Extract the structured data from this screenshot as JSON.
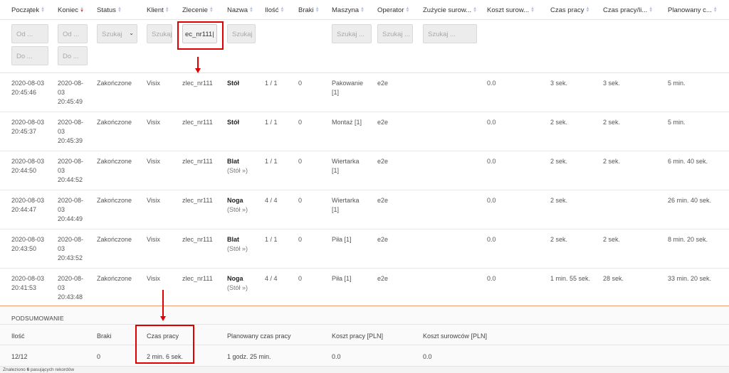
{
  "columns": [
    {
      "label": "Początek",
      "sort": "none"
    },
    {
      "label": "Koniec",
      "sort": "desc"
    },
    {
      "label": "Status",
      "sort": "none"
    },
    {
      "label": "Klient",
      "sort": "none"
    },
    {
      "label": "Zlecenie",
      "sort": "none"
    },
    {
      "label": "Nazwa",
      "sort": "none"
    },
    {
      "label": "Ilość",
      "sort": "none"
    },
    {
      "label": "Braki",
      "sort": "none"
    },
    {
      "label": "Maszyna",
      "sort": "none"
    },
    {
      "label": "Operator",
      "sort": "none"
    },
    {
      "label": "Zużycie surow...",
      "sort": "none"
    },
    {
      "label": "Koszt surow...",
      "sort": "none"
    },
    {
      "label": "Czas pracy",
      "sort": "none"
    },
    {
      "label": "Czas pracy/li...",
      "sort": "none"
    },
    {
      "label": "Planowany c...",
      "sort": "none"
    }
  ],
  "filters": {
    "start_from": "Od ...",
    "start_to": "Do ...",
    "end_from": "Od ...",
    "end_to": "Do ...",
    "status": "Szukaj",
    "client": "Szukaj",
    "order": "ec_nr111|",
    "name": "Szukaj",
    "machine": "Szukaj ...",
    "operator": "Szukaj ...",
    "material": "Szukaj ..."
  },
  "rows": [
    {
      "start_date": "2020-08-03",
      "start_time": "20:45:46",
      "end_date": "2020-08-",
      "end_day": "03",
      "end_time": "20:45:49",
      "status": "Zakończone",
      "client": "Visix",
      "order": "zlec_nr111",
      "name": "Stół",
      "parent": "",
      "qty": "1 / 1",
      "defects": "0",
      "machine": "Pakowanie",
      "machine2": "[1]",
      "operator": "e2e",
      "material_cost": "0.0",
      "work_time": "3 sek.",
      "work_time_per": "3 sek.",
      "planned": "5 min."
    },
    {
      "start_date": "2020-08-03",
      "start_time": "20:45:37",
      "end_date": "2020-08-",
      "end_day": "03",
      "end_time": "20:45:39",
      "status": "Zakończone",
      "client": "Visix",
      "order": "zlec_nr111",
      "name": "Stół",
      "parent": "",
      "qty": "1 / 1",
      "defects": "0",
      "machine": "Montaż [1]",
      "machine2": "",
      "operator": "e2e",
      "material_cost": "0.0",
      "work_time": "2 sek.",
      "work_time_per": "2 sek.",
      "planned": "5 min."
    },
    {
      "start_date": "2020-08-03",
      "start_time": "20:44:50",
      "end_date": "2020-08-",
      "end_day": "03",
      "end_time": "20:44:52",
      "status": "Zakończone",
      "client": "Visix",
      "order": "zlec_nr111",
      "name": "Blat",
      "parent": "(Stół »)",
      "qty": "1 / 1",
      "defects": "0",
      "machine": "Wiertarka",
      "machine2": "[1]",
      "operator": "e2e",
      "material_cost": "0.0",
      "work_time": "2 sek.",
      "work_time_per": "2 sek.",
      "planned": "6 min. 40 sek."
    },
    {
      "start_date": "2020-08-03",
      "start_time": "20:44:47",
      "end_date": "2020-08-",
      "end_day": "03",
      "end_time": "20:44:49",
      "status": "Zakończone",
      "client": "Visix",
      "order": "zlec_nr111",
      "name": "Noga",
      "parent": "(Stół »)",
      "qty": "4 / 4",
      "defects": "0",
      "machine": "Wiertarka",
      "machine2": "[1]",
      "operator": "e2e",
      "material_cost": "0.0",
      "work_time": "2 sek.",
      "work_time_per": "",
      "planned": "26 min. 40 sek."
    },
    {
      "start_date": "2020-08-03",
      "start_time": "20:43:50",
      "end_date": "2020-08-",
      "end_day": "03",
      "end_time": "20:43:52",
      "status": "Zakończone",
      "client": "Visix",
      "order": "zlec_nr111",
      "name": "Blat",
      "parent": "(Stół »)",
      "qty": "1 / 1",
      "defects": "0",
      "machine": "Piła [1]",
      "machine2": "",
      "operator": "e2e",
      "material_cost": "0.0",
      "work_time": "2 sek.",
      "work_time_per": "2 sek.",
      "planned": "8 min. 20 sek."
    },
    {
      "start_date": "2020-08-03",
      "start_time": "20:41:53",
      "end_date": "2020-08-",
      "end_day": "03",
      "end_time": "20:43:48",
      "status": "Zakończone",
      "client": "Visix",
      "order": "zlec_nr111",
      "name": "Noga",
      "parent": "(Stół »)",
      "qty": "4 / 4",
      "defects": "0",
      "machine": "Piła [1]",
      "machine2": "",
      "operator": "e2e",
      "material_cost": "0.0",
      "work_time": "1 min. 55 sek.",
      "work_time_per": "28 sek.",
      "planned": "33 min. 20 sek."
    }
  ],
  "summary": {
    "title": "PODSUMOWANIE",
    "headers": {
      "qty": "Ilość",
      "defects": "Braki",
      "work_time": "Czas pracy",
      "planned": "Planowany czas pracy",
      "labor_cost": "Koszt pracy [PLN]",
      "material_cost": "Koszt surowców [PLN]"
    },
    "values": {
      "qty": "12/12",
      "defects": "0",
      "work_time": "2 min. 6 sek.",
      "planned": "1 godz. 25 min.",
      "labor_cost": "0.0",
      "material_cost": "0.0"
    }
  },
  "footer": {
    "prefix": "Znaleziono ",
    "count": "6",
    "suffix": " pasujących rekordów"
  },
  "colors": {
    "highlight": "#e00000",
    "summary_border": "#f0a070",
    "input_bg": "#ececec"
  }
}
